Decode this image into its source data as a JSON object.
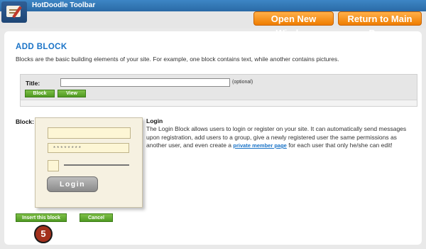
{
  "toolbar": {
    "title": "HotDoodle Toolbar",
    "logo_icon": "hotdoodle-logo-icon",
    "open_new_window_label": "Open New Window",
    "return_main_label": "Return to Main Page",
    "accent_color": "#f28a17"
  },
  "page": {
    "heading": "ADD BLOCK",
    "intro": "Blocks are the basic building elements of your site. For example, one block contains text, while another contains pictures."
  },
  "form": {
    "title_label": "Title:",
    "title_value": "",
    "title_hint": "(optional)",
    "block_button": "Block",
    "view_button": "View"
  },
  "block": {
    "label": "Block:",
    "preview": {
      "password_mask": "********",
      "login_button": "Login"
    },
    "description_title": "Login",
    "description_before_link": "The Login Block allows users to login or register on your site. It can automatically send messages upon registration, add users to a group, give a newly registered user the same permissions as another user, and even create a ",
    "link_text": "private member page",
    "description_after_link": " for each user that only he/she can edit!"
  },
  "actions": {
    "insert_label": "Insert this block",
    "cancel_label": "Cancel"
  },
  "step": {
    "number": "5"
  }
}
